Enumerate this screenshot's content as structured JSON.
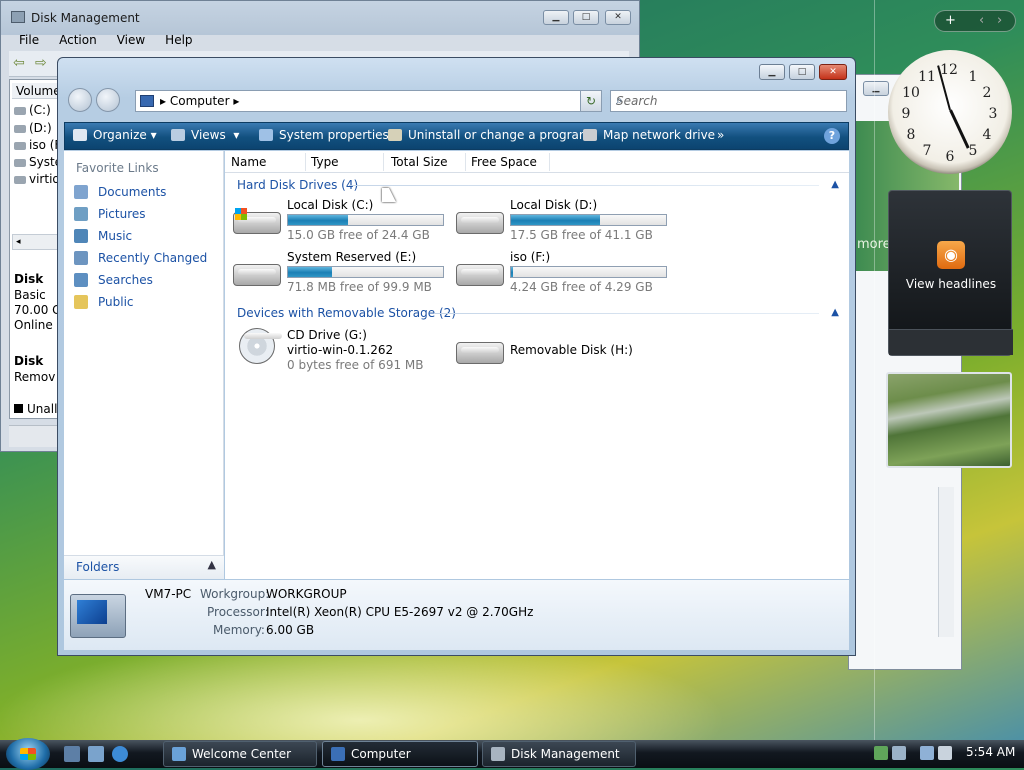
{
  "disk_management": {
    "title": "Disk Management",
    "menu": [
      "File",
      "Action",
      "View",
      "Help"
    ],
    "column": "Volume",
    "volumes": [
      "(C:)",
      "(D:)",
      "iso (F",
      "Syste",
      "virtio"
    ],
    "disk0": {
      "name": "Disk",
      "type": "Basic",
      "size": "70.00 G",
      "status": "Online"
    },
    "disk1": {
      "name": "Disk",
      "type": "Remov"
    },
    "legend": "Unallo"
  },
  "welcome_center": {
    "partial_text": "more"
  },
  "gadgets": {
    "feed_label": "View headlines",
    "clock_numbers": [
      "12",
      "1",
      "2",
      "3",
      "4",
      "5",
      "6",
      "7",
      "8",
      "9",
      "10",
      "11"
    ],
    "controls": [
      "+",
      "‹",
      "›"
    ]
  },
  "computer_window": {
    "address_path": "Computer",
    "search_placeholder": "Search",
    "command_bar": [
      "Organize",
      "Views",
      "System properties",
      "Uninstall or change a program",
      "Map network drive",
      "»"
    ],
    "favorite_links_header": "Favorite Links",
    "favorite_links": [
      "Documents",
      "Pictures",
      "Music",
      "Recently Changed",
      "Searches",
      "Public"
    ],
    "folders_label": "Folders",
    "columns": [
      "Name",
      "Type",
      "Total Size",
      "Free Space"
    ],
    "groups": {
      "hard_disks": "Hard Disk Drives (4)",
      "removable": "Devices with Removable Storage (2)"
    },
    "drives": [
      {
        "name": "Local Disk (C:)",
        "free": "15.0 GB free of 24.4 GB",
        "used_fraction": 0.385
      },
      {
        "name": "Local Disk (D:)",
        "free": "17.5 GB free of 41.1 GB",
        "used_fraction": 0.574
      },
      {
        "name": "System Reserved (E:)",
        "free": "71.8 MB free of 99.9 MB",
        "used_fraction": 0.281
      },
      {
        "name": "iso (F:)",
        "free": "4.24 GB free of 4.29 GB",
        "used_fraction": 0.012
      }
    ],
    "removable": [
      {
        "name": "CD Drive (G:)",
        "label": "virtio-win-0.1.262",
        "free": "0 bytes free of 691 MB"
      },
      {
        "name": "Removable Disk (H:)"
      }
    ],
    "details": {
      "computer_name": "VM7-PC",
      "workgroup_label": "Workgroup:",
      "workgroup": "WORKGROUP",
      "processor_label": "Processor:",
      "processor": "Intel(R) Xeon(R) CPU E5-2697 v2 @ 2.70GHz",
      "memory_label": "Memory:",
      "memory": "6.00 GB"
    }
  },
  "taskbar": {
    "tasks": [
      "Welcome Center",
      "Computer",
      "Disk Management"
    ],
    "time": "5:54 AM"
  }
}
